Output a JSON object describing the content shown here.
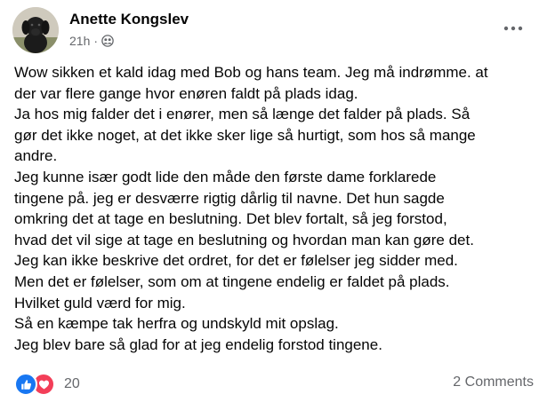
{
  "post": {
    "author": "Anette Kongslev",
    "time": "21h",
    "separator": "·",
    "audience_icon": "friends-icon",
    "more_icon": "more-options-icon",
    "lines": [
      "Wow sikken et kald idag med Bob og hans team. Jeg må indrømme. at",
      "der var flere gange hvor enøren faldt på plads idag.",
      "Ja hos mig falder det i enører, men så længe det falder på plads. Så",
      "gør det ikke noget, at det ikke sker lige så hurtigt, som hos så mange",
      "andre.",
      "Jeg kunne især godt lide den måde den første dame forklarede",
      "tingene på. jeg er desværre rigtig dårlig til navne. Det hun sagde",
      "omkring det at tage en beslutning. Det blev fortalt,  så jeg forstod,",
      "hvad det vil sige at tage en beslutning og hvordan man kan gøre det.",
      "Jeg kan ikke beskrive det ordret, for det er følelser jeg sidder med.",
      "Men det er følelser, som om at tingene endelig er faldet på plads.",
      "Hvilket guld værd for mig.",
      "Så en kæmpe tak herfra og undskyld mit opslag.",
      "Jeg blev bare så glad for at jeg endelig forstod tingene."
    ]
  },
  "footer": {
    "reaction_icons": [
      "like-icon",
      "love-icon"
    ],
    "reaction_count": "20",
    "comments_label": "2 Comments"
  },
  "colors": {
    "text": "#050505",
    "secondary": "#65676b",
    "like": "#1877f2",
    "love": "#f33e58"
  }
}
